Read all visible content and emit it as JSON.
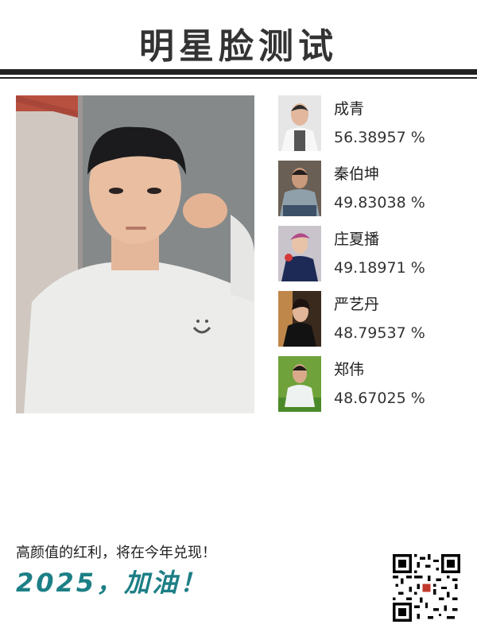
{
  "header": {
    "title": "明星脸测试"
  },
  "results": [
    {
      "name": "成青",
      "score": "56.38957 %"
    },
    {
      "name": "秦伯坤",
      "score": "49.83038 %"
    },
    {
      "name": "庄夏播",
      "score": "49.18971 %"
    },
    {
      "name": "严艺丹",
      "score": "48.79537 %"
    },
    {
      "name": "郑伟",
      "score": "48.67025 %"
    }
  ],
  "footer": {
    "line1": "高颜值的红利，将在今年兑现！",
    "line2": "2025，加油！"
  },
  "colors": {
    "accent": "#1d7f86",
    "ink": "#222222"
  }
}
